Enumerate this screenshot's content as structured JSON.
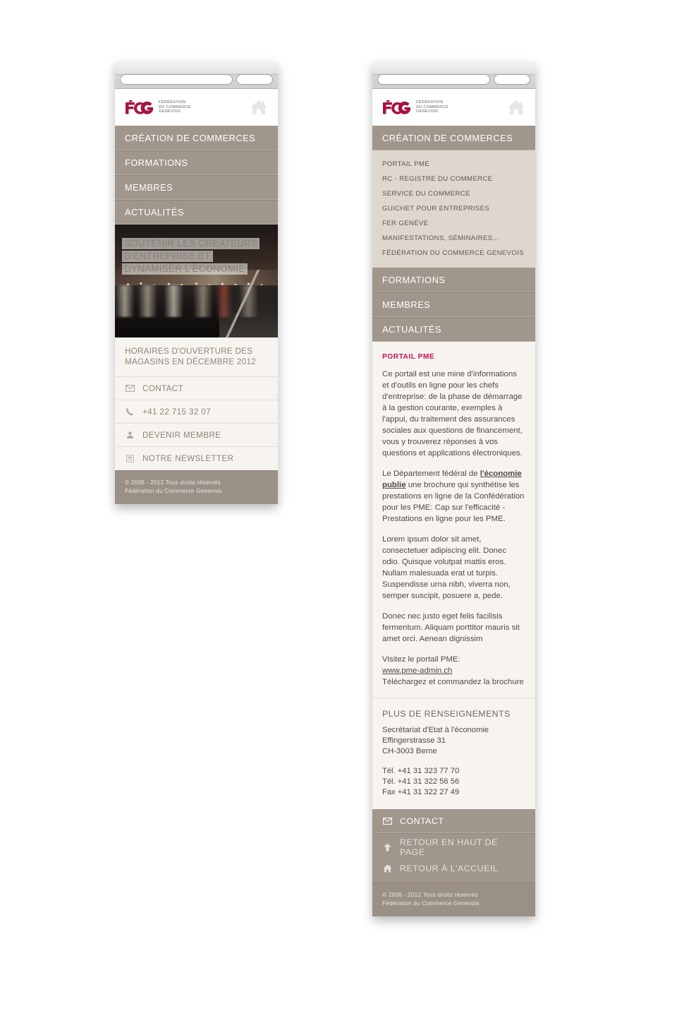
{
  "brand": {
    "logo_text": "FCG",
    "logo_line1": "FÉDÉRATION",
    "logo_line2": "DU COMMERCE",
    "logo_line3": "GENEVOIS",
    "accent_color": "#a8133f",
    "heading_color": "#c8145a",
    "nav_color": "#a0968c",
    "submenu_color": "#ddd7cd",
    "panel_color": "#f7f4f0"
  },
  "chrome": {
    "url_value": "",
    "url_placeholder": "",
    "button_label": ""
  },
  "header": {
    "home_icon": "home-icon"
  },
  "nav": {
    "items": [
      {
        "label": "CRÉATION DE COMMERCES"
      },
      {
        "label": "FORMATIONS"
      },
      {
        "label": "MEMBRES"
      },
      {
        "label": "ACTUALITÉS"
      }
    ]
  },
  "submenu": {
    "items": [
      {
        "label": "PORTAIL PME"
      },
      {
        "label": "RC - REGISTRE DU COMMERCE"
      },
      {
        "label": "SERVICE DU COMMERCE"
      },
      {
        "label": "GUICHET POUR ENTREPRISES"
      },
      {
        "label": "FER GENÈVE"
      },
      {
        "label": "MANIFESTATIONS, SÉMINAIRES..."
      },
      {
        "label": "FÉDÉRATION DU COMMERCE GENEVOIS"
      }
    ]
  },
  "hero": {
    "line1": "SOUTENIR LES CREATEURS",
    "line2": "D'ENTREPRISE ET",
    "line3": "DYNAMISER L'ECONOMIE",
    "image_alt": "night-cityscape-geneva"
  },
  "home_page": {
    "teaser": "HORAIRES D'OUVERTURE DES MAGASINS EN DÉCEMBRE 2012",
    "rows": [
      {
        "icon": "envelope-icon",
        "label": "CONTACT"
      },
      {
        "icon": "phone-icon",
        "label": "+41 22 715 32 07"
      },
      {
        "icon": "person-icon",
        "label": "DEVENIR MEMBRE"
      },
      {
        "icon": "newsletter-icon",
        "label": "NOTRE NEWSLETTER"
      }
    ]
  },
  "article": {
    "heading": "PORTAIL PME",
    "p1": "Ce portail est une mine d'informations et d'outils en ligne pour les chefs d'entreprise: de la phase de démarrage à la gestion courante, exemples à l'appui, du traitement des assurances sociales aux questions de financement, vous y trouverez réponses à vos questions et applications électroniques.",
    "p2_before": "Le Département fédéral de ",
    "p2_link": "l'économie publie",
    "p2_after": " une brochure qui synthétise les prestations en ligne de la Confédération pour les PME: Cap sur l'efficacité - Prestations en ligne pour les PME.",
    "p3": "Lorem ipsum dolor sit amet, consectetuer adipiscing elit. Donec odio. Quisque volutpat mattis eros. Nullam malesuada erat ut turpis. Suspendisse urna nibh, viverra non, semper suscipit, posuere a, pede.",
    "p4": "Donec nec justo eget felis facilisis fermentum. Aliquam porttitor mauris sit amet orci. Aenean dignissim",
    "p5_intro": "Visitez le portail PME:",
    "p5_link": "www.pme-admin.ch",
    "p5_after": "Téléchargez et commandez la brochure"
  },
  "info": {
    "heading": "PLUS DE RENSEIGNEMENTS",
    "org": "Secrétariat d'Etat à l'économie",
    "street": "Effingerstrasse 31",
    "city": "CH-3003 Berne",
    "tel1": "Tél. +41 31 323 77 70",
    "tel2": "Tél. +41 31 322 56 56",
    "fax": "Fax +41 31 322 27 49"
  },
  "footer_nav": {
    "contact": {
      "icon": "envelope-icon",
      "label": "CONTACT"
    },
    "back_to_top": {
      "icon": "arrow-up-icon",
      "label": "RETOUR EN HAUT DE PAGE"
    },
    "back_home": {
      "icon": "home-icon",
      "label": "RETOUR À L'ACCUEIL"
    }
  },
  "copyright": {
    "line1": "© 2006 - 2012 Tous droits réservés",
    "line2": "Fédération du Commerce Genevois"
  }
}
